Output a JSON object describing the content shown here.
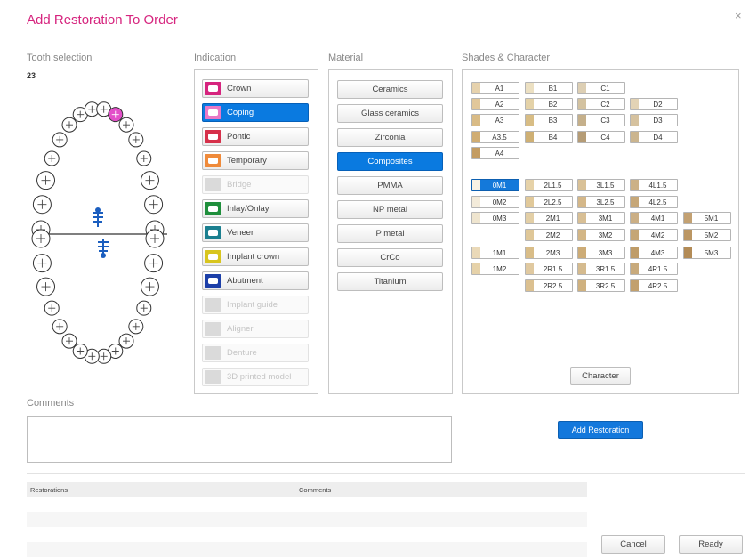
{
  "dialog": {
    "title": "Add Restoration To Order",
    "close_symbol": "×"
  },
  "tooth_selection": {
    "label": "Tooth selection",
    "selected_tooth": "23"
  },
  "indication": {
    "label": "Indication",
    "items": [
      {
        "label": "Crown",
        "color": "#d6247e",
        "state": "normal"
      },
      {
        "label": "Coping",
        "color": "#e879c6",
        "state": "selected"
      },
      {
        "label": "Pontic",
        "color": "#d6304a",
        "state": "normal"
      },
      {
        "label": "Temporary",
        "color": "#ef8a3a",
        "state": "normal"
      },
      {
        "label": "Bridge",
        "color": "#dadada",
        "state": "disabled"
      },
      {
        "label": "Inlay/Onlay",
        "color": "#1f8f3c",
        "state": "normal"
      },
      {
        "label": "Veneer",
        "color": "#1b7f8f",
        "state": "normal"
      },
      {
        "label": "Implant crown",
        "color": "#d8c51e",
        "state": "normal"
      },
      {
        "label": "Abutment",
        "color": "#1c3fa8",
        "state": "normal"
      },
      {
        "label": "Implant guide",
        "color": "#dadada",
        "state": "disabled"
      },
      {
        "label": "Aligner",
        "color": "#dadada",
        "state": "disabled"
      },
      {
        "label": "Denture",
        "color": "#dadada",
        "state": "disabled"
      },
      {
        "label": "3D printed model",
        "color": "#dadada",
        "state": "disabled"
      }
    ]
  },
  "material": {
    "label": "Material",
    "items": [
      {
        "label": "Ceramics",
        "state": "normal"
      },
      {
        "label": "Glass ceramics",
        "state": "normal"
      },
      {
        "label": "Zirconia",
        "state": "normal"
      },
      {
        "label": "Composites",
        "state": "selected"
      },
      {
        "label": "PMMA",
        "state": "normal"
      },
      {
        "label": "NP metal",
        "state": "normal"
      },
      {
        "label": "P metal",
        "state": "normal"
      },
      {
        "label": "CrCo",
        "state": "normal"
      },
      {
        "label": "Titanium",
        "state": "normal"
      }
    ]
  },
  "shades": {
    "label": "Shades & Character",
    "vita_classic": [
      {
        "label": "A1",
        "color": "#e6d2ad"
      },
      {
        "label": "A2",
        "color": "#e1c79a"
      },
      {
        "label": "A3",
        "color": "#d9bb85"
      },
      {
        "label": "A3.5",
        "color": "#d0ad73"
      },
      {
        "label": "A4",
        "color": "#c39c62"
      },
      {
        "label": "B1",
        "color": "#ece0c2"
      },
      {
        "label": "B2",
        "color": "#e4d2a8"
      },
      {
        "label": "B3",
        "color": "#d8bd85"
      },
      {
        "label": "B4",
        "color": "#cfb074"
      },
      {
        "label": "C1",
        "color": "#ddcfb4"
      },
      {
        "label": "C2",
        "color": "#d3c2a0"
      },
      {
        "label": "C3",
        "color": "#c5b08b"
      },
      {
        "label": "C4",
        "color": "#b59c76"
      },
      {
        "label": "D2",
        "color": "#e3d3b5"
      },
      {
        "label": "D3",
        "color": "#d6c29f"
      },
      {
        "label": "D4",
        "color": "#cbb58f"
      }
    ],
    "vita_3d": [
      {
        "label": "0M1",
        "color": "#f7f1e4",
        "selected": true
      },
      {
        "label": "0M2",
        "color": "#f3ebda"
      },
      {
        "label": "0M3",
        "color": "#efe5cf"
      },
      {
        "label": "1M1",
        "color": "#ead9b8"
      },
      {
        "label": "1M2",
        "color": "#e6d2a9"
      },
      {
        "label": "2L1.5",
        "color": "#e6d2a8"
      },
      {
        "label": "2L2.5",
        "color": "#e1c99a"
      },
      {
        "label": "2M1",
        "color": "#e3cfa6"
      },
      {
        "label": "2M2",
        "color": "#dfc798"
      },
      {
        "label": "2M3",
        "color": "#d9bd88"
      },
      {
        "label": "2R1.5",
        "color": "#e0c9a0"
      },
      {
        "label": "2R2.5",
        "color": "#dbc090"
      },
      {
        "label": "3L1.5",
        "color": "#d9c197"
      },
      {
        "label": "3L2.5",
        "color": "#d4b789"
      },
      {
        "label": "3M1",
        "color": "#d8bf95"
      },
      {
        "label": "3M2",
        "color": "#d3b686"
      },
      {
        "label": "3M3",
        "color": "#cdac77"
      },
      {
        "label": "3R1.5",
        "color": "#d5bb8f"
      },
      {
        "label": "3R2.5",
        "color": "#cfb17f"
      },
      {
        "label": "4L1.5",
        "color": "#ccb186"
      },
      {
        "label": "4L2.5",
        "color": "#c6a778"
      },
      {
        "label": "4M1",
        "color": "#cbaf85"
      },
      {
        "label": "4M2",
        "color": "#c5a676"
      },
      {
        "label": "4M3",
        "color": "#bf9c68"
      },
      {
        "label": "4R1.5",
        "color": "#c8aa7c"
      },
      {
        "label": "4R2.5",
        "color": "#c2a06d"
      },
      {
        "label": "5M1",
        "color": "#c3a172"
      },
      {
        "label": "5M2",
        "color": "#bb9663"
      },
      {
        "label": "5M3",
        "color": "#b38b56"
      }
    ],
    "character_label": "Character"
  },
  "comments": {
    "label": "Comments",
    "value": ""
  },
  "add_restoration_label": "Add Restoration",
  "restorations_table": {
    "headers": [
      "Restorations",
      "Comments"
    ],
    "rows": []
  },
  "footer": {
    "cancel_label": "Cancel",
    "ready_label": "Ready"
  },
  "colors": {
    "accent": "#d6247e",
    "primary_button": "#1378dc",
    "selected_tooth": "#e34fc9"
  }
}
